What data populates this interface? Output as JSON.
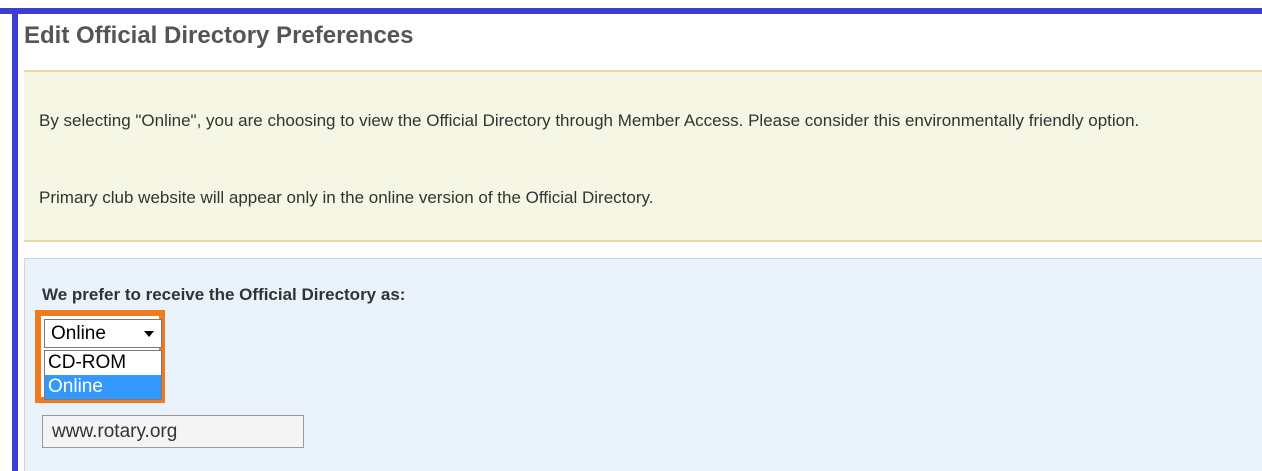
{
  "page": {
    "title": "Edit Official Directory Preferences"
  },
  "notice": {
    "line1": "By selecting \"Online\", you are choosing to view the Official Directory through Member Access. Please consider this environmentally friendly option.",
    "line2": "Primary club website will appear only in the online version of the Official Directory."
  },
  "preference": {
    "label": "We prefer to receive the Official Directory as:",
    "selected": "Online",
    "options": [
      "CD-ROM",
      "Online"
    ],
    "highlighted_option": "Online"
  },
  "website": {
    "value": "www.rotary.org"
  },
  "colors": {
    "frame": "#3d3dd4",
    "highlight_border": "#f07a1e",
    "option_selected_bg": "#3399ff",
    "notice_bg": "#f5f6e4",
    "form_bg": "#eaf2fb"
  }
}
